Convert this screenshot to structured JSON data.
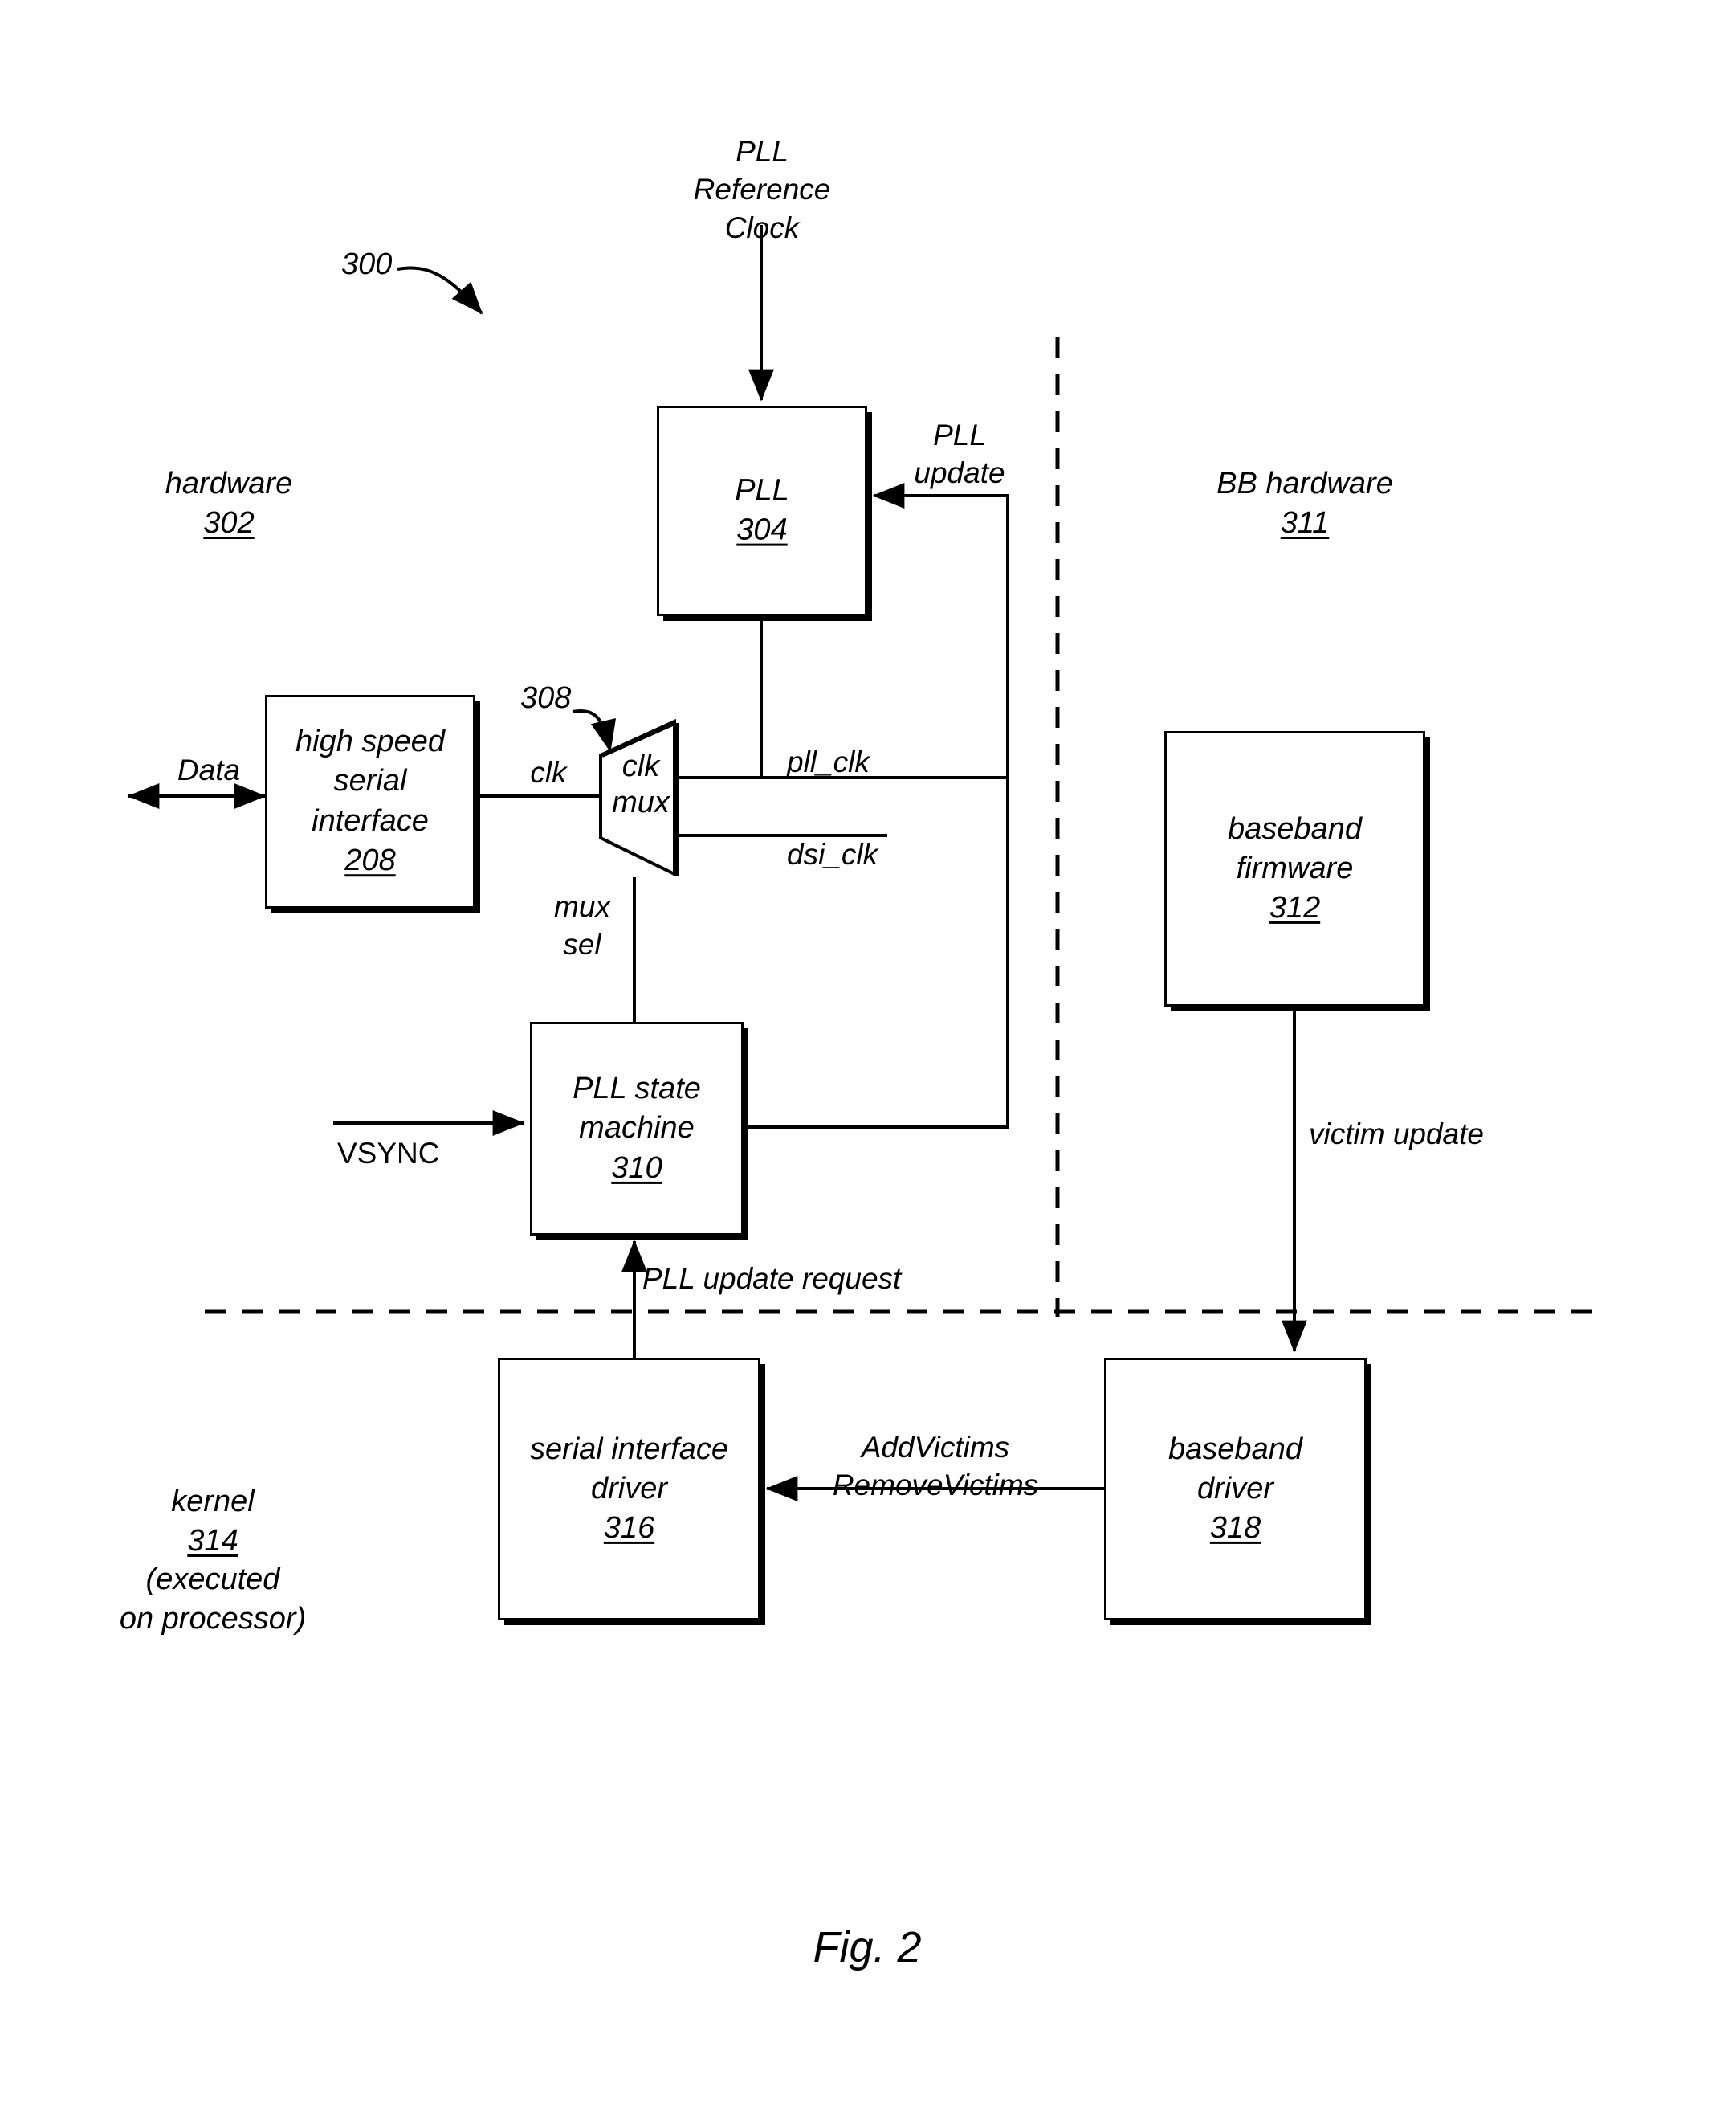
{
  "figure": {
    "caption": "Fig. 2",
    "system_ref": "300"
  },
  "domains": {
    "hardware": {
      "label": "hardware",
      "ref": "302"
    },
    "bb_hardware": {
      "label": "BB hardware",
      "ref": "311"
    },
    "kernel": {
      "label": "kernel",
      "ref": "314",
      "note_line1": "(executed",
      "note_line2": "on processor)"
    }
  },
  "blocks": {
    "pll": {
      "name": "PLL",
      "ref": "304"
    },
    "hssi": {
      "name": "high speed\nserial\ninterface",
      "ref": "208"
    },
    "clk_mux": {
      "name": "clk\nmux",
      "ref": "308"
    },
    "pll_sm": {
      "name": "PLL state\nmachine",
      "ref": "310"
    },
    "bb_fw": {
      "name": "baseband\nfirmware",
      "ref": "312"
    },
    "si_driver": {
      "name": "serial interface\ndriver",
      "ref": "316"
    },
    "bb_driver": {
      "name": "baseband\ndriver",
      "ref": "318"
    }
  },
  "signals": {
    "pll_reference_clock": "PLL\nReference\nClock",
    "pll_update": "PLL\nupdate",
    "pll_clk": "pll_clk",
    "dsi_clk": "dsi_clk",
    "clk": "clk",
    "mux_sel": "mux\nsel",
    "data": "Data",
    "vsync": "VSYNC",
    "pll_update_request": "PLL update request",
    "victim_update": "victim update",
    "add_remove_victims": "AddVictims\nRemoveVictims"
  },
  "colors": {
    "ink": "#000000",
    "paper": "#ffffff"
  }
}
